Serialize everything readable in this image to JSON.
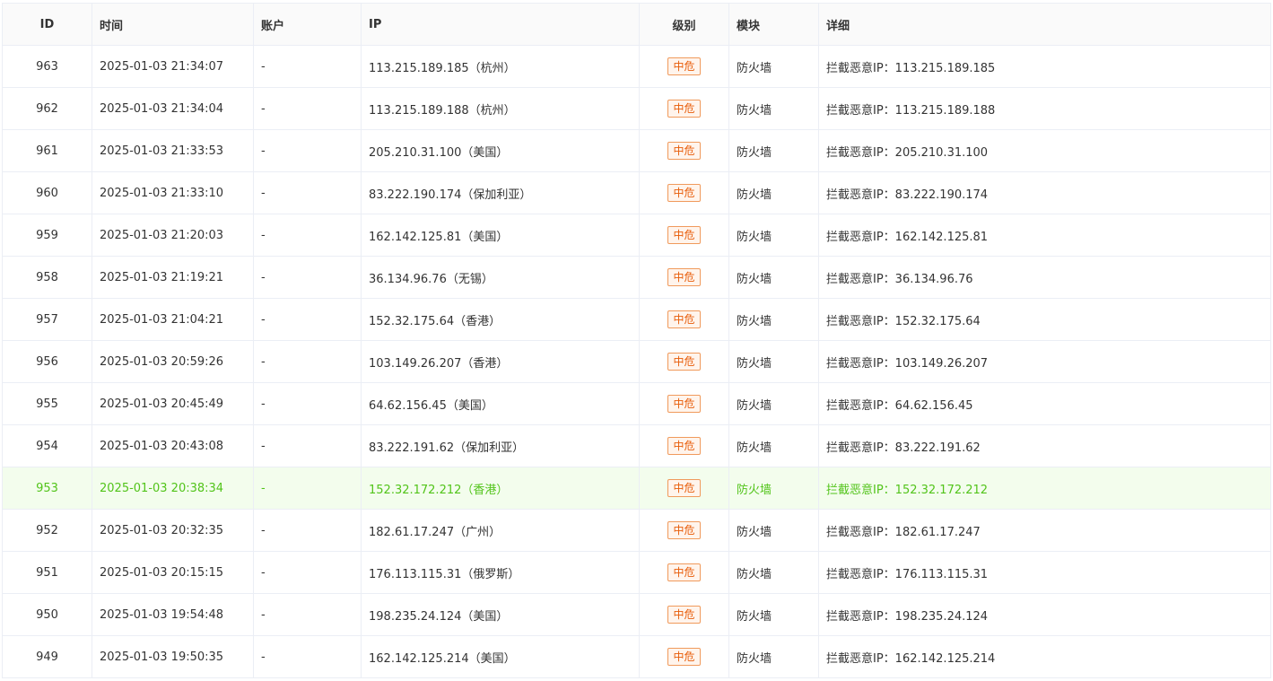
{
  "headers": {
    "id": "ID",
    "time": "时间",
    "account": "账户",
    "ip": "IP",
    "level": "级别",
    "module": "模块",
    "detail": "详细"
  },
  "rows": [
    {
      "id": "963",
      "time": "2025-01-03 21:34:07",
      "account": "-",
      "ip": "113.215.189.185（杭州）",
      "level": "中危",
      "module": "防火墙",
      "detail": "拦截恶意IP：113.215.189.185"
    },
    {
      "id": "962",
      "time": "2025-01-03 21:34:04",
      "account": "-",
      "ip": "113.215.189.188（杭州）",
      "level": "中危",
      "module": "防火墙",
      "detail": "拦截恶意IP：113.215.189.188"
    },
    {
      "id": "961",
      "time": "2025-01-03 21:33:53",
      "account": "-",
      "ip": "205.210.31.100（美国）",
      "level": "中危",
      "module": "防火墙",
      "detail": "拦截恶意IP：205.210.31.100"
    },
    {
      "id": "960",
      "time": "2025-01-03 21:33:10",
      "account": "-",
      "ip": "83.222.190.174（保加利亚）",
      "level": "中危",
      "module": "防火墙",
      "detail": "拦截恶意IP：83.222.190.174"
    },
    {
      "id": "959",
      "time": "2025-01-03 21:20:03",
      "account": "-",
      "ip": "162.142.125.81（美国）",
      "level": "中危",
      "module": "防火墙",
      "detail": "拦截恶意IP：162.142.125.81"
    },
    {
      "id": "958",
      "time": "2025-01-03 21:19:21",
      "account": "-",
      "ip": "36.134.96.76（无锡）",
      "level": "中危",
      "module": "防火墙",
      "detail": "拦截恶意IP：36.134.96.76"
    },
    {
      "id": "957",
      "time": "2025-01-03 21:04:21",
      "account": "-",
      "ip": "152.32.175.64（香港）",
      "level": "中危",
      "module": "防火墙",
      "detail": "拦截恶意IP：152.32.175.64"
    },
    {
      "id": "956",
      "time": "2025-01-03 20:59:26",
      "account": "-",
      "ip": "103.149.26.207（香港）",
      "level": "中危",
      "module": "防火墙",
      "detail": "拦截恶意IP：103.149.26.207"
    },
    {
      "id": "955",
      "time": "2025-01-03 20:45:49",
      "account": "-",
      "ip": "64.62.156.45（美国）",
      "level": "中危",
      "module": "防火墙",
      "detail": "拦截恶意IP：64.62.156.45"
    },
    {
      "id": "954",
      "time": "2025-01-03 20:43:08",
      "account": "-",
      "ip": "83.222.191.62（保加利亚）",
      "level": "中危",
      "module": "防火墙",
      "detail": "拦截恶意IP：83.222.191.62"
    },
    {
      "id": "953",
      "time": "2025-01-03 20:38:34",
      "account": "-",
      "ip": "152.32.172.212（香港）",
      "level": "中危",
      "module": "防火墙",
      "detail": "拦截恶意IP：152.32.172.212",
      "highlighted": true
    },
    {
      "id": "952",
      "time": "2025-01-03 20:32:35",
      "account": "-",
      "ip": "182.61.17.247（广州）",
      "level": "中危",
      "module": "防火墙",
      "detail": "拦截恶意IP：182.61.17.247"
    },
    {
      "id": "951",
      "time": "2025-01-03 20:15:15",
      "account": "-",
      "ip": "176.113.115.31（俄罗斯）",
      "level": "中危",
      "module": "防火墙",
      "detail": "拦截恶意IP：176.113.115.31"
    },
    {
      "id": "950",
      "time": "2025-01-03 19:54:48",
      "account": "-",
      "ip": "198.235.24.124（美国）",
      "level": "中危",
      "module": "防火墙",
      "detail": "拦截恶意IP：198.235.24.124"
    },
    {
      "id": "949",
      "time": "2025-01-03 19:50:35",
      "account": "-",
      "ip": "162.142.125.214（美国）",
      "level": "中危",
      "module": "防火墙",
      "detail": "拦截恶意IP：162.142.125.214"
    }
  ],
  "colors": {
    "tag_border": "#f09a5c",
    "tag_text": "#e85d0a",
    "highlight_bg": "#f3fded",
    "highlight_text": "#52c41a"
  }
}
